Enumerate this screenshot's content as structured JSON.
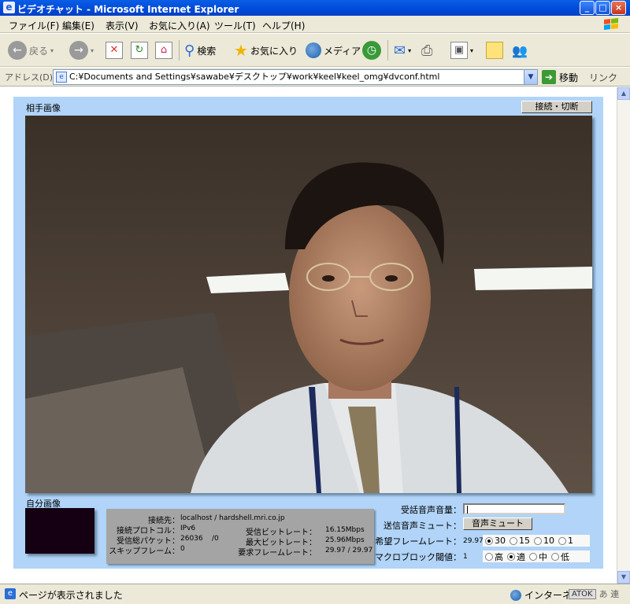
{
  "window": {
    "title": "ビデオチャット - Microsoft Internet Explorer",
    "app_icon": "ie-page-icon",
    "minimize": "_",
    "maximize": "□",
    "close": "×"
  },
  "menu": [
    "ファイル(F)",
    "編集(E)",
    "表示(V)",
    "お気に入り(A)",
    "ツール(T)",
    "ヘルプ(H)"
  ],
  "toolbar": {
    "back": "戻る",
    "search": "検索",
    "favorites": "お気に入り",
    "media": "メディア"
  },
  "address": {
    "label": "アドレス(D)",
    "url": "C:¥Documents and Settings¥sawabe¥デスクトップ¥work¥keel¥keel_omg¥dvconf.html",
    "go": "移動",
    "links": "リンク"
  },
  "page": {
    "remote_label": "相手画像",
    "connect_button": "接続・切断",
    "self_label": "自分画像",
    "stats": {
      "dest_label": "接続先：",
      "dest_value": "localhost / hardshell.mri.co.jp",
      "protocol_label": "接続プロトコル：",
      "protocol_value": "IPv6",
      "packets_label": "受信総パケット：",
      "packets_value": "26036",
      "packets_lost": "/0",
      "skip_label": "スキップフレーム：",
      "skip_value": "0",
      "rxbit_label": "受信ビットレート：",
      "rxbit_value": "16.15Mbps",
      "maxbit_label": "最大ビットレート：",
      "maxbit_value": "25.96Mbps",
      "reqframe_label": "要求フレームレート：",
      "reqframe_value": "29.97 / 29.97"
    },
    "controls": {
      "rx_volume_label": "受話音声音量：",
      "rx_volume_level": 0.01,
      "tx_mute_label": "送信音声ミュート：",
      "mute_button": "音声ミュート",
      "framerate_label": "希望フレームレート：",
      "framerate_value": "29.97",
      "framerate_options": [
        "30",
        "15",
        "10",
        "1"
      ],
      "framerate_selected": "30",
      "macroblock_label": "マクロブロック閾値：",
      "macroblock_value": "1",
      "macroblock_options": [
        "高",
        "適",
        "中",
        "低"
      ],
      "macroblock_selected": "適"
    }
  },
  "status": {
    "text": "ページが表示されました",
    "zone": "インターネット",
    "ime": "ATOK",
    "ime_mode": "あ 連"
  },
  "colors": {
    "titlebar": "#0054e3",
    "panel": "#b1d4f8",
    "chrome": "#ece9d8"
  }
}
